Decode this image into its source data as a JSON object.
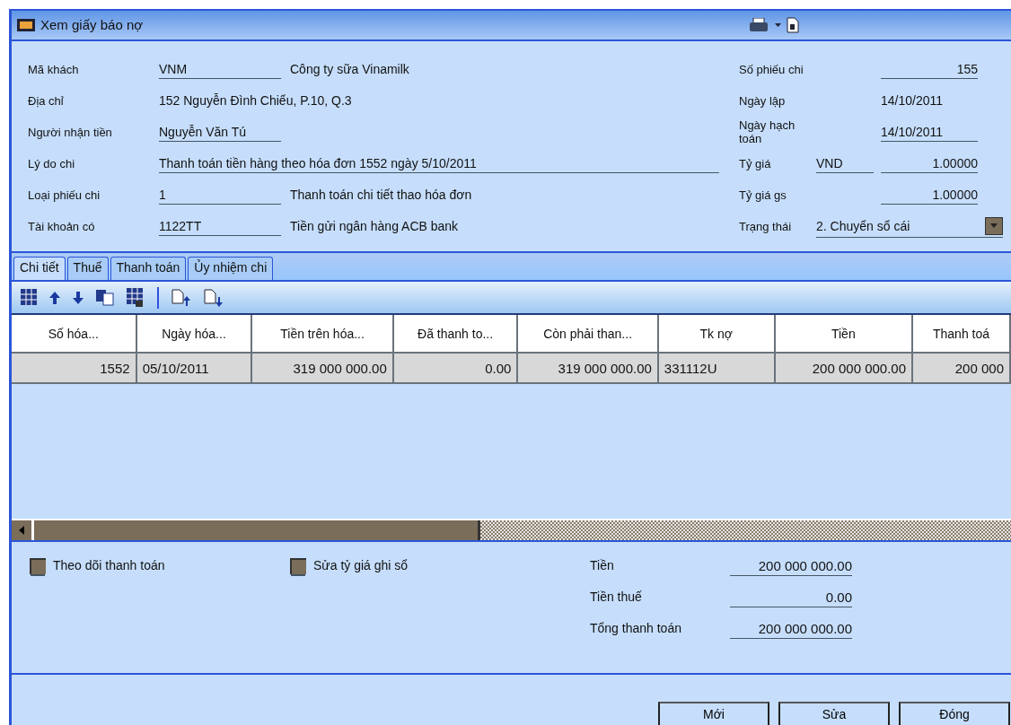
{
  "window": {
    "title": "Xem giấy báo nợ"
  },
  "header_left": [
    {
      "label": "Mã khách",
      "value": "VNM",
      "description": "Công ty sữa Vinamilk",
      "kind": "field"
    },
    {
      "label": "Địa chỉ",
      "value": "152 Nguyễn Đình Chiểu, P.10, Q.3",
      "kind": "plain"
    },
    {
      "label": "Người nhận tiền",
      "value": "Nguyễn Văn Tú",
      "kind": "field"
    },
    {
      "label": "Lý do chi",
      "value": "Thanh toán tiền hàng theo hóa đơn 1552 ngày 5/10/2011",
      "kind": "wide"
    },
    {
      "label": "Loại phiếu chi",
      "value": "1",
      "description": "Thanh toán chi tiết thao hóa đơn",
      "kind": "field"
    },
    {
      "label": "Tài khoản có",
      "value": "1122TT",
      "description": "Tiền gửi ngân hàng ACB bank",
      "kind": "field"
    }
  ],
  "header_right": [
    {
      "label": "Số phiếu chi",
      "value": "155",
      "kind": "number"
    },
    {
      "label": "Ngày lập",
      "value": "14/10/2011",
      "kind": "plain"
    },
    {
      "label": "Ngày hạch toán",
      "value": "14/10/2011",
      "kind": "field"
    },
    {
      "label": "Tỷ giá",
      "currency": "VND",
      "value": "1.00000",
      "kind": "rate"
    },
    {
      "label": "Tỷ giá gs",
      "value": "1.00000",
      "kind": "number"
    },
    {
      "label": "Trạng thái",
      "value": "2. Chuyển sổ cái",
      "kind": "dropdown"
    }
  ],
  "tabs": [
    {
      "label": "Chi tiết",
      "selected": true
    },
    {
      "label": "Thuế",
      "selected": false
    },
    {
      "label": "Thanh toán",
      "selected": false
    },
    {
      "label": "Ủy nhiệm chi",
      "selected": false
    }
  ],
  "table": {
    "columns": [
      "Số hóa...",
      "Ngày hóa...",
      "Tiền trên hóa...",
      "Đã thanh to...",
      "Còn phải than...",
      "Tk nợ",
      "Tiền",
      "Thanh toá"
    ],
    "rows": [
      {
        "selected": true,
        "cells": [
          "1552",
          "05/10/2011",
          "319 000 000.00",
          "0.00",
          "319 000 000.00",
          "331112U",
          "200 000 000.00",
          "200 000"
        ]
      }
    ]
  },
  "options": [
    {
      "label": "Theo dõi thanh toán",
      "checked": false
    },
    {
      "label": "Sửa tỷ giá ghi sổ",
      "checked": false
    }
  ],
  "totals": [
    {
      "label": "Tiền",
      "value": "200 000 000.00"
    },
    {
      "label": "Tiền thuế",
      "value": "0.00"
    },
    {
      "label": "Tổng thanh toán",
      "value": "200 000 000.00"
    }
  ],
  "buttons": [
    "Mới",
    "Sửa",
    "Đóng"
  ]
}
